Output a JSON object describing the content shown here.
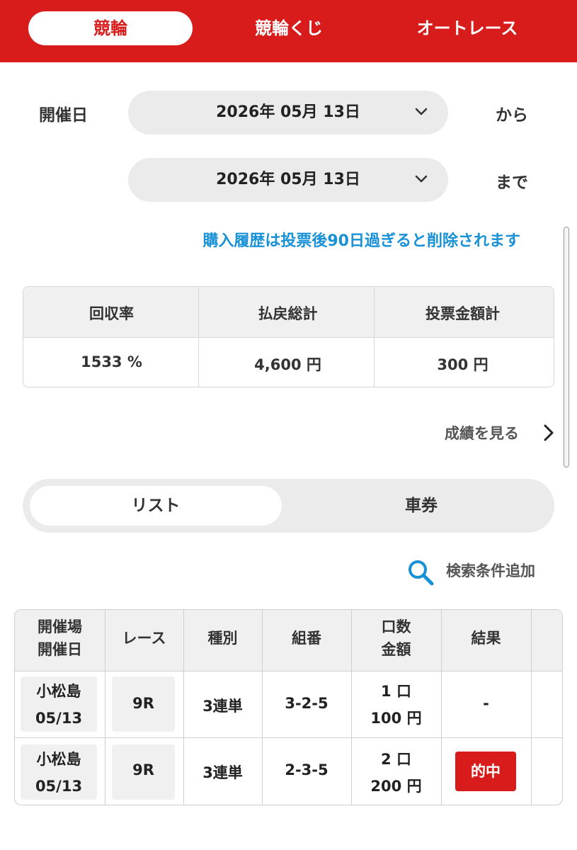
{
  "tabs": [
    {
      "label": "競輪",
      "active": true
    },
    {
      "label": "競輪くじ",
      "active": false
    },
    {
      "label": "オートレース",
      "active": false
    }
  ],
  "date_range": {
    "label": "開催日",
    "from": {
      "value": "2026年 05月 13日",
      "suffix": "から"
    },
    "to": {
      "value": "2026年 05月 13日",
      "suffix": "まで"
    }
  },
  "notice": "購入履歴は投票後90日過ぎると削除されます",
  "summary": {
    "headers": [
      "回収率",
      "払戻総計",
      "投票金額計"
    ],
    "values": [
      "1533 %",
      "4,600 円",
      "300 円"
    ]
  },
  "results_link": "成績を見る",
  "view_toggle": {
    "list": "リスト",
    "ticket": "車券",
    "selected": "リスト"
  },
  "search_filter": "検索条件追加",
  "table": {
    "headers": {
      "venue_line1": "開催場",
      "venue_line2": "開催日",
      "race": "レース",
      "type": "種別",
      "combo": "組番",
      "qty_line1": "口数",
      "qty_line2": "金額",
      "result": "結果"
    },
    "rows": [
      {
        "venue": "小松島",
        "date": "05/13",
        "race": "9R",
        "type": "3連単",
        "combo": "3-2-5",
        "qty": "1 口",
        "amount": "100 円",
        "result": "-"
      },
      {
        "venue": "小松島",
        "date": "05/13",
        "race": "9R",
        "type": "3連単",
        "combo": "2-3-5",
        "qty": "2 口",
        "amount": "200 円",
        "result": "的中"
      }
    ]
  },
  "colors": {
    "brand_red": "#d81c1c",
    "notice_blue": "#1891d6",
    "panel_gray": "#ebebeb"
  }
}
